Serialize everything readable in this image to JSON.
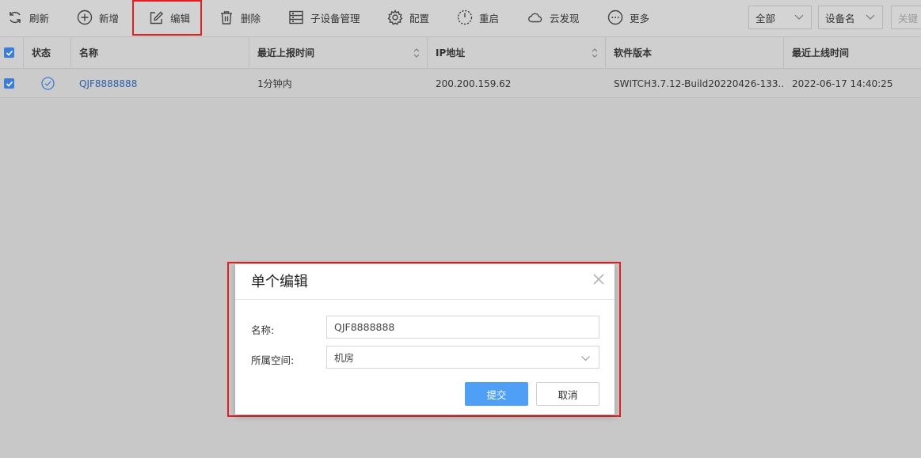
{
  "toolbar": {
    "refresh": "刷新",
    "add": "新增",
    "edit": "编辑",
    "delete": "删除",
    "sub_device": "子设备管理",
    "config": "配置",
    "restart": "重启",
    "cloud_discover": "云发现",
    "more": "更多",
    "filter_all": "全部",
    "filter_field": "设备名",
    "keyword_placeholder": "关键"
  },
  "table": {
    "columns": [
      "状态",
      "名称",
      "最近上报时间",
      "IP地址",
      "软件版本",
      "最近上线时间"
    ],
    "rows": [
      {
        "name": "QJF8888888",
        "last_report": "1分钟内",
        "ip": "200.200.159.62",
        "software": "SWITCH3.7.12-Build20220426-133...",
        "last_online": "2022-06-17 14:40:25"
      }
    ]
  },
  "modal": {
    "title": "单个编辑",
    "name_label": "名称:",
    "name_value": "QJF8888888",
    "space_label": "所属空间:",
    "space_value": "机房",
    "submit": "提交",
    "cancel": "取消"
  },
  "colors": {
    "accent": "#4e9ff5",
    "highlight_border": "#e02020",
    "link": "#2a5ea8",
    "checkbox": "#3b7dd8"
  }
}
